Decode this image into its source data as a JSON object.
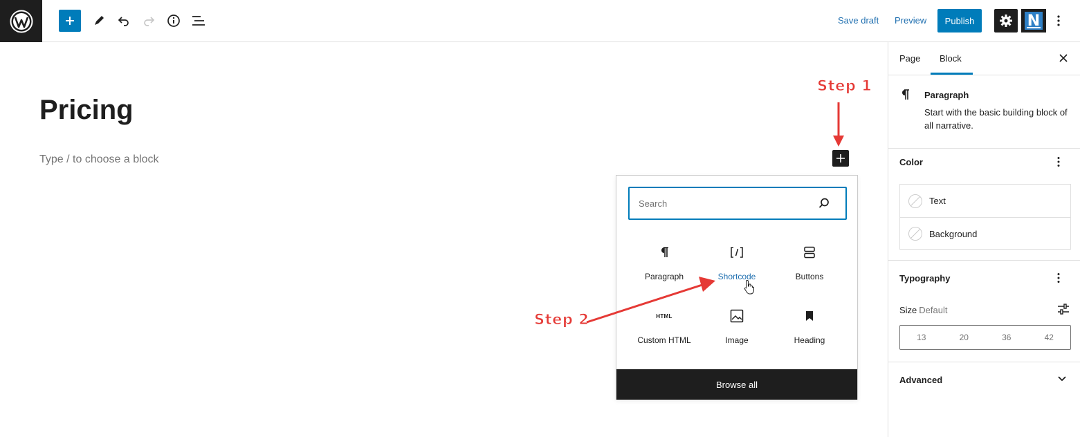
{
  "toolbar": {
    "save_draft": "Save draft",
    "preview": "Preview",
    "publish": "Publish",
    "n_logo_letter": "N"
  },
  "editor": {
    "title": "Pricing",
    "placeholder": "Type / to choose a block"
  },
  "inserter": {
    "search_placeholder": "Search",
    "blocks": [
      {
        "label": "Paragraph",
        "icon": "paragraph-icon"
      },
      {
        "label": "Shortcode",
        "icon": "shortcode-icon"
      },
      {
        "label": "Buttons",
        "icon": "buttons-icon"
      },
      {
        "label": "Custom HTML",
        "icon": "html-icon",
        "icon_text": "HTML"
      },
      {
        "label": "Image",
        "icon": "image-icon"
      },
      {
        "label": "Heading",
        "icon": "bookmark-icon"
      }
    ],
    "browse_all": "Browse all"
  },
  "annotations": {
    "step1": "Step 1",
    "step2": "Step 2"
  },
  "sidebar": {
    "tabs": [
      "Page",
      "Block"
    ],
    "active_tab": "Block",
    "block": {
      "title": "Paragraph",
      "description": "Start with the basic building block of all narrative."
    },
    "color": {
      "title": "Color",
      "items": [
        "Text",
        "Background"
      ]
    },
    "typography": {
      "title": "Typography",
      "size_label": "Size",
      "size_value": "Default",
      "sizes": [
        "13",
        "20",
        "36",
        "42"
      ]
    },
    "advanced": {
      "title": "Advanced"
    }
  },
  "colors": {
    "accent": "#007cba",
    "dark": "#1e1e1e",
    "annotation": "#e53935"
  }
}
